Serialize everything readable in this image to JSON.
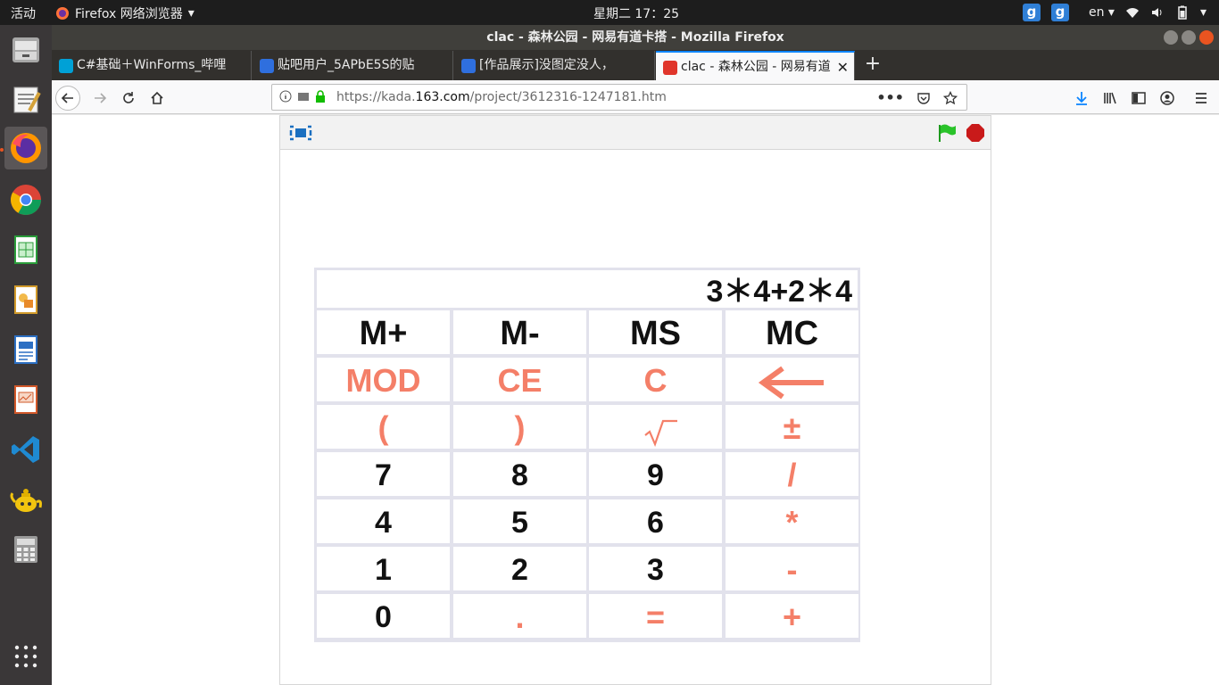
{
  "topbar": {
    "activities": "活动",
    "app_menu": "Firefox 网络浏览器",
    "clock": "星期二 17：25",
    "input_badge_1": "g",
    "input_badge_2": "g",
    "language": "en"
  },
  "window": {
    "title": "clac - 森林公园 - 网易有道卡搭 - Mozilla Firefox"
  },
  "tabs": [
    {
      "label": "C#基础＋WinForms_哔哩",
      "icon_color": "#00a1d6"
    },
    {
      "label": "贴吧用户_5APbE5S的贴",
      "icon_color": "#2f6fde"
    },
    {
      "label": "[作品展示]没图定没人，",
      "icon_color": "#2f6fde"
    },
    {
      "label": "clac - 森林公园 - 网易有道",
      "icon_color": "#e0352b"
    }
  ],
  "url": {
    "prefix": "https://kada.",
    "domain": "163.com",
    "path": "/project/3612316-1247181.htm"
  },
  "calculator": {
    "display": "3＊4+2＊4",
    "keys": [
      {
        "label": "M+",
        "style": "black"
      },
      {
        "label": "M-",
        "style": "black"
      },
      {
        "label": "MS",
        "style": "black"
      },
      {
        "label": "MC",
        "style": "black"
      },
      {
        "label": "MOD",
        "style": "orange"
      },
      {
        "label": "CE",
        "style": "orange"
      },
      {
        "label": "C",
        "style": "orange"
      },
      {
        "label": "",
        "style": "orange",
        "icon": "backspace-arrow-icon"
      },
      {
        "label": "(",
        "style": "orange"
      },
      {
        "label": ")",
        "style": "orange"
      },
      {
        "label": "",
        "style": "orange",
        "icon": "square-root-icon"
      },
      {
        "label": "±",
        "style": "orange"
      },
      {
        "label": "7",
        "style": "digit"
      },
      {
        "label": "8",
        "style": "digit"
      },
      {
        "label": "9",
        "style": "digit"
      },
      {
        "label": "/",
        "style": "orange"
      },
      {
        "label": "4",
        "style": "digit"
      },
      {
        "label": "5",
        "style": "digit"
      },
      {
        "label": "6",
        "style": "digit"
      },
      {
        "label": "*",
        "style": "orange"
      },
      {
        "label": "1",
        "style": "digit"
      },
      {
        "label": "2",
        "style": "digit"
      },
      {
        "label": "3",
        "style": "digit"
      },
      {
        "label": "-",
        "style": "orange"
      },
      {
        "label": "0",
        "style": "digit"
      },
      {
        "label": ".",
        "style": "orange"
      },
      {
        "label": "=",
        "style": "orange"
      },
      {
        "label": "+",
        "style": "orange"
      }
    ]
  },
  "colors": {
    "accent_orange": "#f47f68",
    "firefox_blue": "#0a84ff",
    "ubuntu_orange": "#e95420"
  }
}
